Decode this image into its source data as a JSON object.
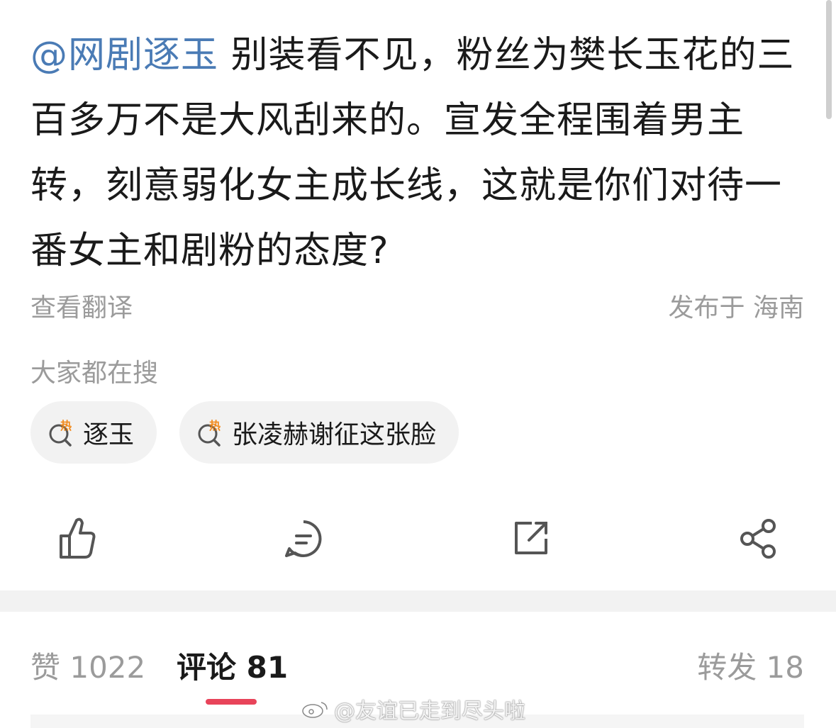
{
  "post": {
    "mention": "@网剧逐玉",
    "body": " 别装看不见，粉丝为樊长玉花的三百多万不是大风刮来的。宣发全程围着男主转，刻意弱化女主成长线，这就是你们对待一番女主和剧粉的态度?"
  },
  "meta": {
    "translate": "查看翻译",
    "location": "发布于 海南"
  },
  "search": {
    "title": "大家都在搜",
    "chips": [
      {
        "label": "逐玉",
        "badge": "热"
      },
      {
        "label": "张凌赫谢征这张脸",
        "badge": "热"
      }
    ]
  },
  "actions": {
    "icons": [
      "like-icon",
      "comment-icon",
      "repost-icon",
      "share-icon"
    ]
  },
  "stats": {
    "like": "赞 1022",
    "comment": "评论 81",
    "repost": "转发 18"
  },
  "watermark": {
    "text": "@友谊已走到尽头啦"
  },
  "colors": {
    "mention": "#4a7bb5",
    "accent": "#e8445a",
    "hot": "#f28a1c"
  }
}
